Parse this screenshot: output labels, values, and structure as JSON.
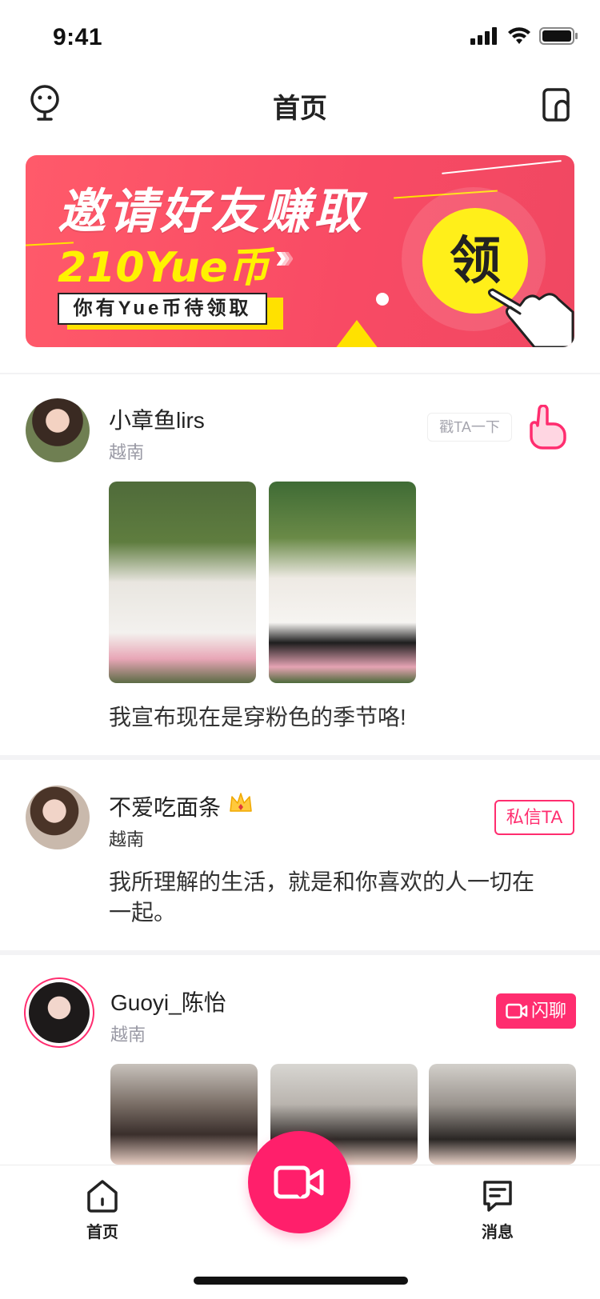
{
  "status_bar": {
    "time": "9:41"
  },
  "header": {
    "title": "首页"
  },
  "banner": {
    "title": "邀请好友赚取",
    "amount": "210Yue币",
    "subtitle": "你有Yue币待领取",
    "cta": "领",
    "colors": {
      "background": "#f84a64",
      "accent": "#ffef1a"
    }
  },
  "posts": [
    {
      "name": "小章鱼lirs",
      "location": "越南",
      "action_label": "戳TA一下",
      "text": "我宣布现在是穿粉色的季节咯!",
      "photos": 2
    },
    {
      "name": "不爱吃面条",
      "location": "越南",
      "action_label": "私信TA",
      "badge_icon": "crown-icon",
      "text_line1": "我所理解的生活，就是和你喜欢的人一切在",
      "text_line2": "一起。"
    },
    {
      "name": "Guoyi_陈怡",
      "location": "越南",
      "action_label": "闪聊",
      "photos": 3
    }
  ],
  "tabbar": {
    "home_label": "首页",
    "messages_label": "消息"
  },
  "colors": {
    "brand": "#ff2d6f"
  }
}
